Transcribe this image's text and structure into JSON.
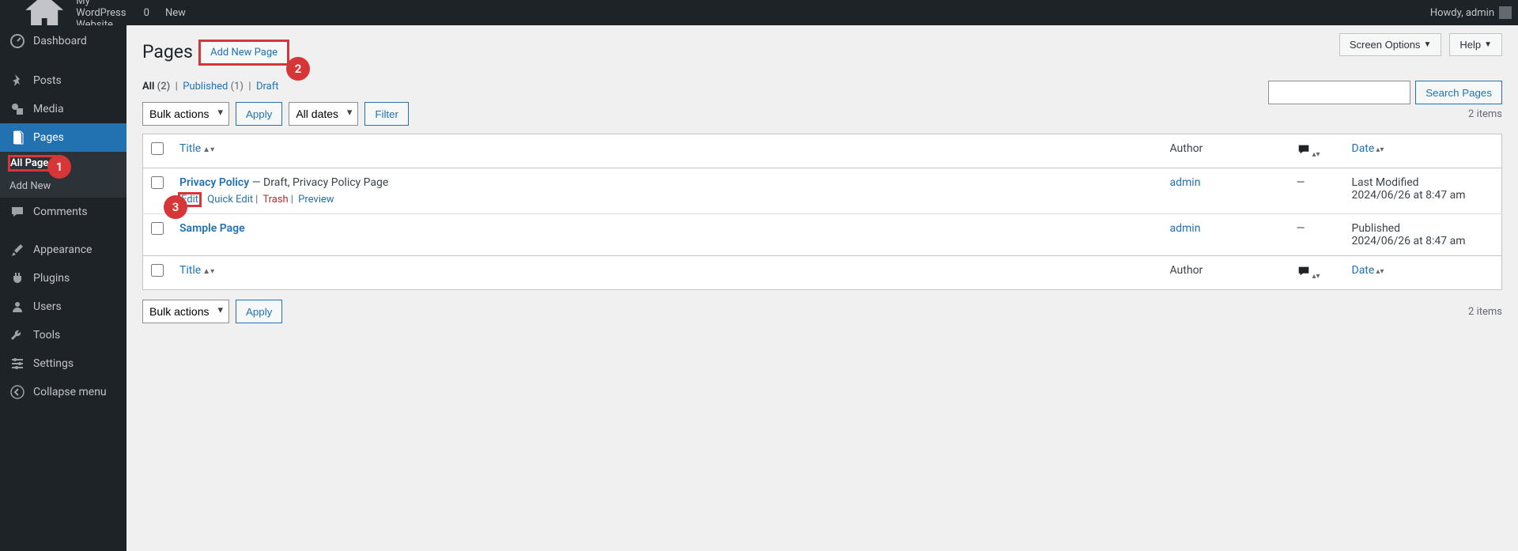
{
  "topbar": {
    "site_name": "My WordPress Website",
    "comments_count": "0",
    "new_label": "New",
    "howdy_label": "Howdy, admin"
  },
  "top_actions": {
    "screen_options": "Screen Options",
    "help": "Help"
  },
  "sidebar": {
    "dashboard": "Dashboard",
    "posts": "Posts",
    "media": "Media",
    "pages": "Pages",
    "all_pages": "All Pages",
    "add_new": "Add New",
    "comments": "Comments",
    "appearance": "Appearance",
    "plugins": "Plugins",
    "users": "Users",
    "tools": "Tools",
    "settings": "Settings",
    "collapse": "Collapse menu"
  },
  "page": {
    "title": "Pages",
    "add_new": "Add New Page"
  },
  "filters": {
    "all_label": "All",
    "all_count": "(2)",
    "published_label": "Published",
    "published_count": "(1)",
    "draft_label": "Draft",
    "bulk_actions": "Bulk actions",
    "apply": "Apply",
    "all_dates": "All dates",
    "filter": "Filter",
    "items_count": "2 items"
  },
  "search": {
    "button": "Search Pages"
  },
  "columns": {
    "title": "Title",
    "author": "Author",
    "date": "Date"
  },
  "row_actions": {
    "edit": "Edit",
    "quick_edit": "Quick Edit",
    "trash": "Trash",
    "preview": "Preview"
  },
  "rows": [
    {
      "title": "Privacy Policy",
      "state": " — Draft, Privacy Policy Page",
      "author": "admin",
      "comments": "—",
      "date_status": "Last Modified",
      "date_time": "2024/06/26 at 8:47 am"
    },
    {
      "title": "Sample Page",
      "state": "",
      "author": "admin",
      "comments": "—",
      "date_status": "Published",
      "date_time": "2024/06/26 at 8:47 am"
    }
  ],
  "annotations": {
    "c1": "1",
    "c2": "2",
    "c3": "3"
  }
}
